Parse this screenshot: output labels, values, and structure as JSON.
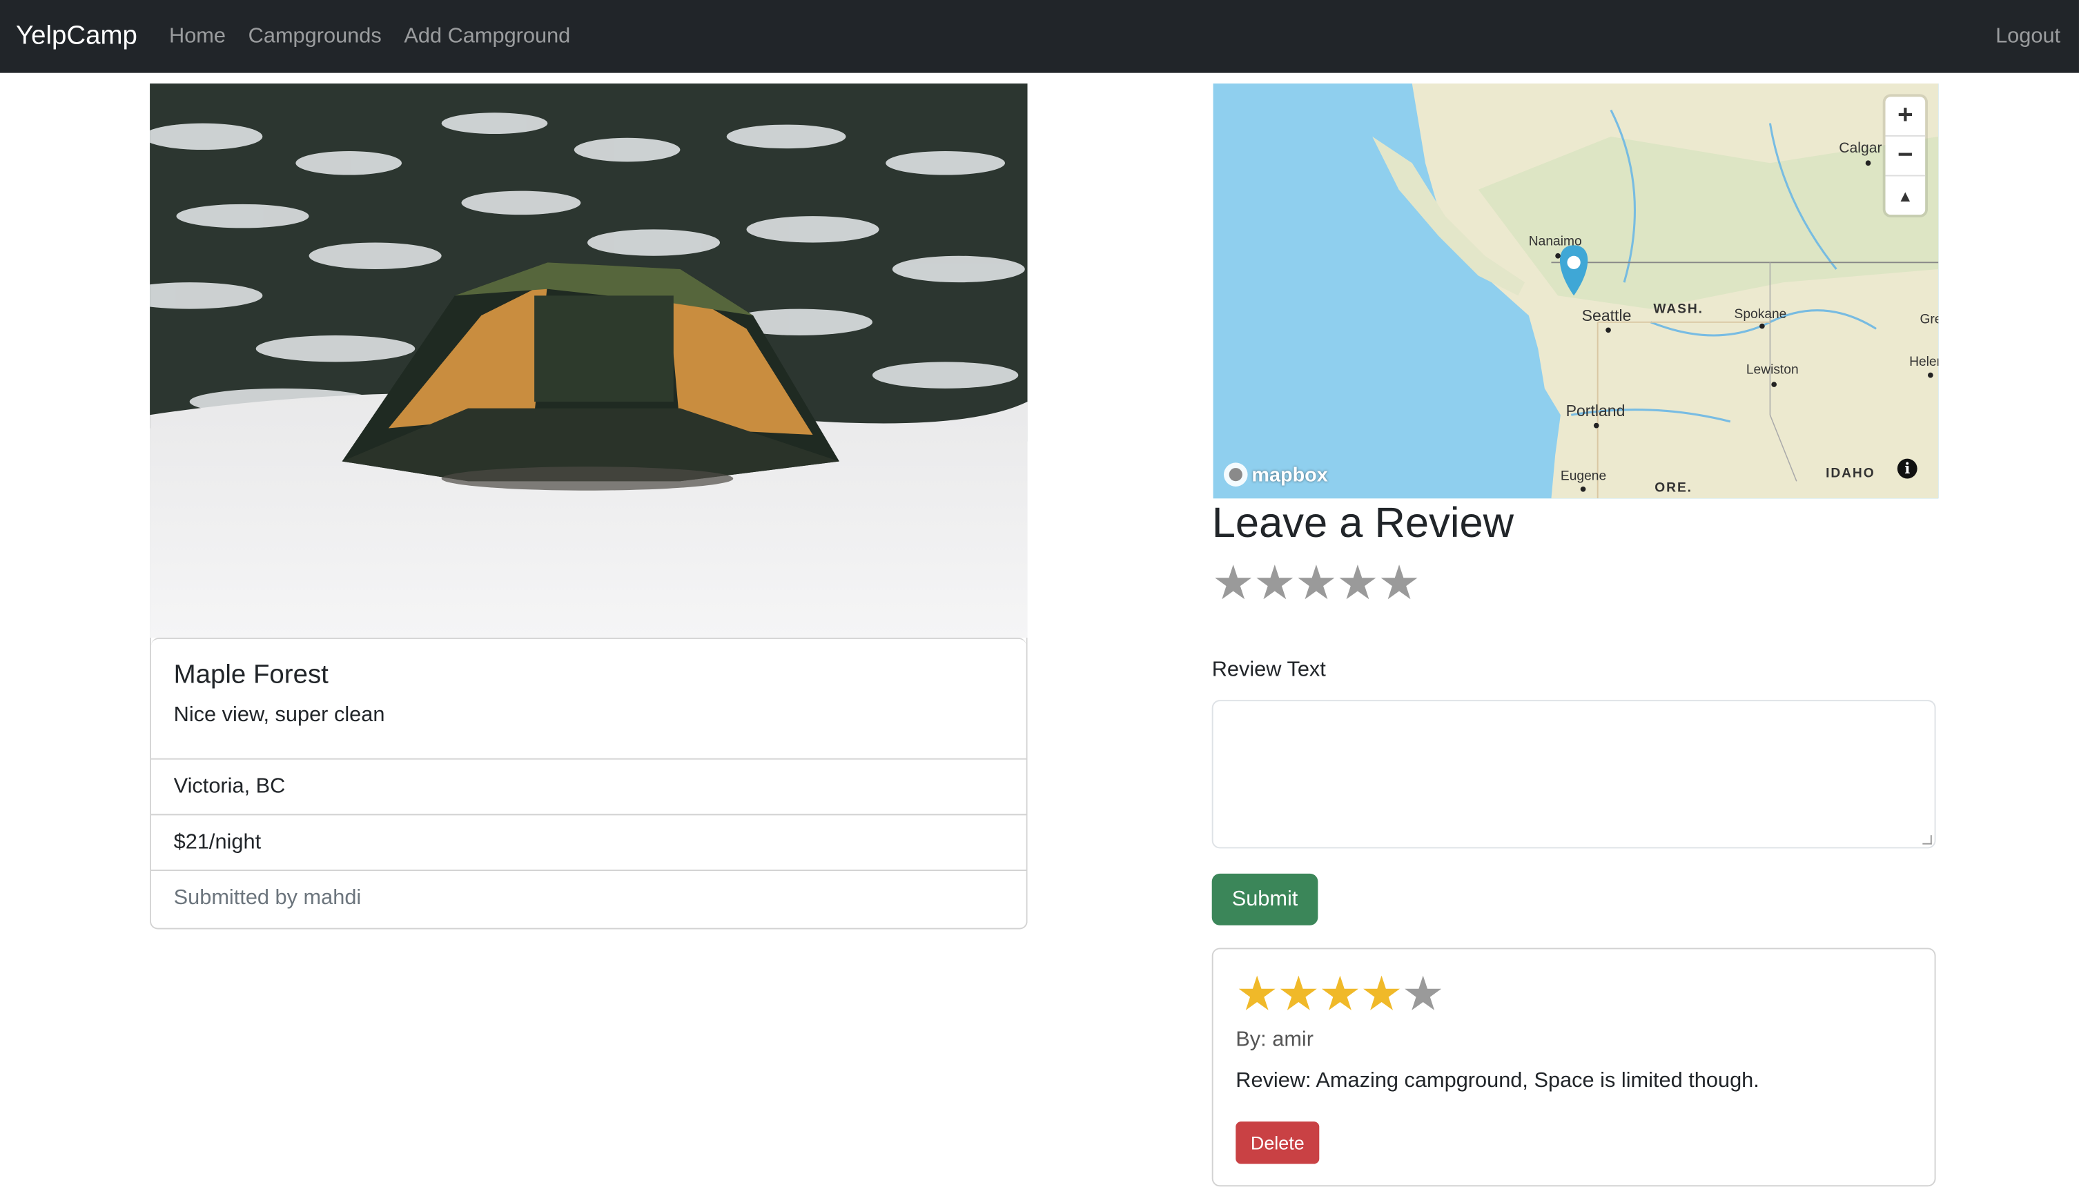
{
  "navbar": {
    "brand": "YelpCamp",
    "links": [
      "Home",
      "Campgrounds",
      "Add Campground"
    ],
    "logout": "Logout"
  },
  "campground": {
    "title": "Maple Forest",
    "description": "Nice view, super clean",
    "location": "Victoria, BC",
    "price": "$21/night",
    "submitted_by": "Submitted by mahdi"
  },
  "map": {
    "attribution_logo": "mapbox",
    "info_icon": "i",
    "labels": [
      "Calgar",
      "Nanaimo",
      "Seattle",
      "WASH.",
      "Spokane",
      "Gre",
      "Helen",
      "Lewiston",
      "Portland",
      "Eugene",
      "ORE.",
      "IDAHO"
    ],
    "controls": {
      "zoom_in": "+",
      "zoom_out": "−",
      "compass": "▲"
    }
  },
  "review_form": {
    "heading": "Leave a Review",
    "rating": 0,
    "rating_max": 5,
    "text_label": "Review Text",
    "text_value": "",
    "submit": "Submit"
  },
  "reviews": [
    {
      "rating": 4,
      "rating_max": 5,
      "author": "By: amir",
      "text": "Review: Amazing campground, Space is limited though.",
      "delete": "Delete"
    }
  ],
  "colors": {
    "navbar_bg": "#212529",
    "submit_bg": "#3b8659",
    "delete_bg": "#c94144",
    "star_filled": "#f0b929",
    "star_empty": "#9a9a9a",
    "water": "#8fcfee"
  }
}
